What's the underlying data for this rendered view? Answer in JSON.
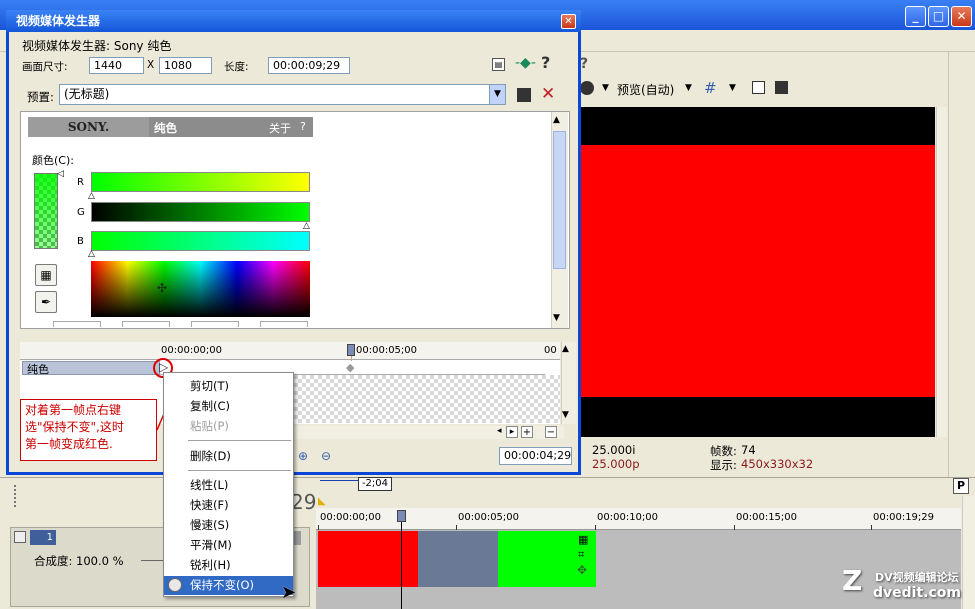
{
  "dialog": {
    "title": "视频媒体发生器",
    "header": "视频媒体发生器: Sony 纯色",
    "frame_size_label": "画面尺寸:",
    "width": "1440",
    "x_label": "X",
    "height": "1080",
    "length_label": "长度:",
    "length": "00:00:09;29",
    "help_symbol": "?",
    "preset_label": "预置:",
    "preset_value": "(无标题)",
    "sony_logo": "SONY.",
    "plugin_name": "纯色",
    "about": "关于",
    "about_help": "?",
    "color_label": "颜色(C):",
    "channel_r": "R",
    "channel_g": "G",
    "channel_b": "B",
    "kf_start": "00:00:00;00",
    "kf_mid": "00:00:05;00",
    "kf_end": "00",
    "kf_track_name": "纯色",
    "kf_current_time": "00:00:04;29"
  },
  "context_menu": {
    "items": [
      {
        "label": "剪切(T)",
        "enabled": true
      },
      {
        "label": "复制(C)",
        "enabled": true
      },
      {
        "label": "粘贴(P)",
        "enabled": false
      },
      {
        "label": "删除(D)",
        "enabled": true
      },
      {
        "label": "线性(L)",
        "enabled": true
      },
      {
        "label": "快速(F)",
        "enabled": true
      },
      {
        "label": "慢速(S)",
        "enabled": true
      },
      {
        "label": "平滑(M)",
        "enabled": true
      },
      {
        "label": "锐利(H)",
        "enabled": true
      },
      {
        "label": "保持不变(O)",
        "enabled": true
      }
    ]
  },
  "annotation": "对着第一帧点右键\n选\"保持不变\",这时\n第一帧变成红色.",
  "preview_toolbar": {
    "preview_quality": "预览(自动)",
    "help": "?"
  },
  "preview_info": {
    "project_rate": "25.000i",
    "preview_rate": "25.000p",
    "frames_label": "帧数:",
    "frames_value": "74",
    "display_label": "显示:",
    "display_value": "450x330x32"
  },
  "timeline": {
    "cursor_time": "-2;04",
    "partial_time": "29",
    "ruler": [
      "00:00:00;00",
      "00:00:05;00",
      "00:00:10;00",
      "00:00:15;00",
      "00:00:19;29"
    ],
    "track_number": "1",
    "opacity_label": "合成度: 100.0 %"
  },
  "watermark": {
    "site": "dvedit.com",
    "cn": "DV视频编辑论坛"
  },
  "colors": {
    "selection_blue": "#316ac5",
    "preview_red": "#ff0000",
    "event_green": "#00ff00",
    "annotation_red": "#cc0000"
  }
}
